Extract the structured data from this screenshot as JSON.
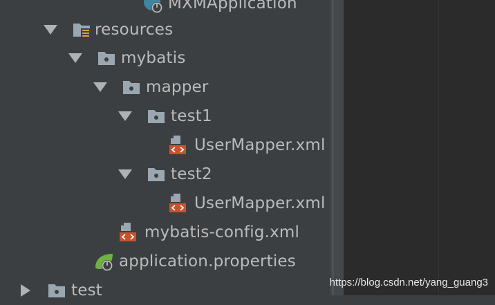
{
  "tree": {
    "items": [
      {
        "label": "MXMApplication",
        "icon": "spring-boot-app-icon",
        "expanded": null
      },
      {
        "label": "resources",
        "icon": "resources-folder-icon",
        "expanded": true
      },
      {
        "label": "mybatis",
        "icon": "folder-icon",
        "expanded": true
      },
      {
        "label": "mapper",
        "icon": "folder-icon",
        "expanded": true
      },
      {
        "label": "test1",
        "icon": "folder-icon",
        "expanded": true
      },
      {
        "label": "UserMapper.xml",
        "icon": "xml-file-icon",
        "expanded": null
      },
      {
        "label": "test2",
        "icon": "folder-icon",
        "expanded": true
      },
      {
        "label": "UserMapper.xml",
        "icon": "xml-file-icon",
        "expanded": null
      },
      {
        "label": "mybatis-config.xml",
        "icon": "xml-file-icon",
        "expanded": null
      },
      {
        "label": "application.properties",
        "icon": "spring-properties-icon",
        "expanded": null
      },
      {
        "label": "test",
        "icon": "folder-icon",
        "expanded": false
      }
    ]
  },
  "watermark": {
    "text": "https://blog.csdn.net/yang_guang3"
  },
  "colors": {
    "panel_bg": "#3c3f41",
    "editor_bg": "#2b2b2b",
    "text": "#bbbbbb",
    "folder": "#9aa7b0",
    "xml_badge": "#c7532c",
    "spring": "#6db33f",
    "app_blue": "#3e86a0"
  }
}
